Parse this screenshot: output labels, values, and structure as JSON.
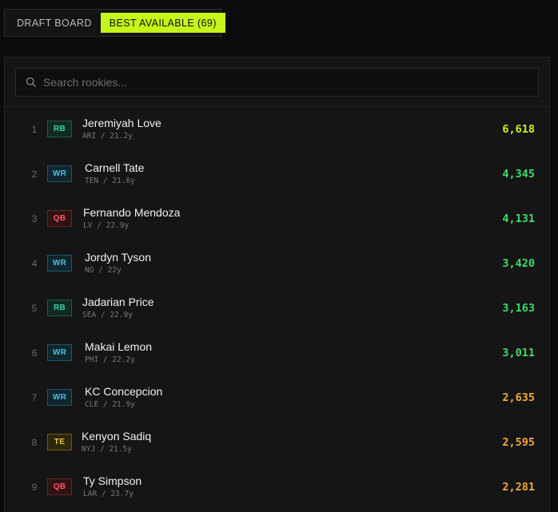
{
  "tabs": [
    {
      "label": "DRAFT BOARD",
      "active": false
    },
    {
      "label": "BEST AVAILABLE (69)",
      "active": true
    }
  ],
  "search": {
    "placeholder": "Search rookies..."
  },
  "players": [
    {
      "rank": "1",
      "pos": "RB",
      "name": "Jeremiyah Love",
      "meta": "ARI / 21.2y",
      "value": "6,618",
      "tier": "lime"
    },
    {
      "rank": "2",
      "pos": "WR",
      "name": "Carnell Tate",
      "meta": "TEN / 21.6y",
      "value": "4,345",
      "tier": "green"
    },
    {
      "rank": "3",
      "pos": "QB",
      "name": "Fernando Mendoza",
      "meta": "LV / 22.9y",
      "value": "4,131",
      "tier": "green"
    },
    {
      "rank": "4",
      "pos": "WR",
      "name": "Jordyn Tyson",
      "meta": "NO / 22y",
      "value": "3,420",
      "tier": "green"
    },
    {
      "rank": "5",
      "pos": "RB",
      "name": "Jadarian Price",
      "meta": "SEA / 22.9y",
      "value": "3,163",
      "tier": "green"
    },
    {
      "rank": "6",
      "pos": "WR",
      "name": "Makai Lemon",
      "meta": "PHI / 22.2y",
      "value": "3,011",
      "tier": "green"
    },
    {
      "rank": "7",
      "pos": "WR",
      "name": "KC Concepcion",
      "meta": "CLE / 21.9y",
      "value": "2,635",
      "tier": "orange"
    },
    {
      "rank": "8",
      "pos": "TE",
      "name": "Kenyon Sadiq",
      "meta": "NYJ / 21.5y",
      "value": "2,595",
      "tier": "orange"
    },
    {
      "rank": "9",
      "pos": "QB",
      "name": "Ty Simpson",
      "meta": "LAR / 23.7y",
      "value": "2,281",
      "tier": "orange"
    }
  ],
  "colors": {
    "accent": "#c6f51c",
    "value_green": "#3ddc6a",
    "value_orange": "#f2a93b"
  },
  "icons": {
    "search": "search-icon"
  }
}
